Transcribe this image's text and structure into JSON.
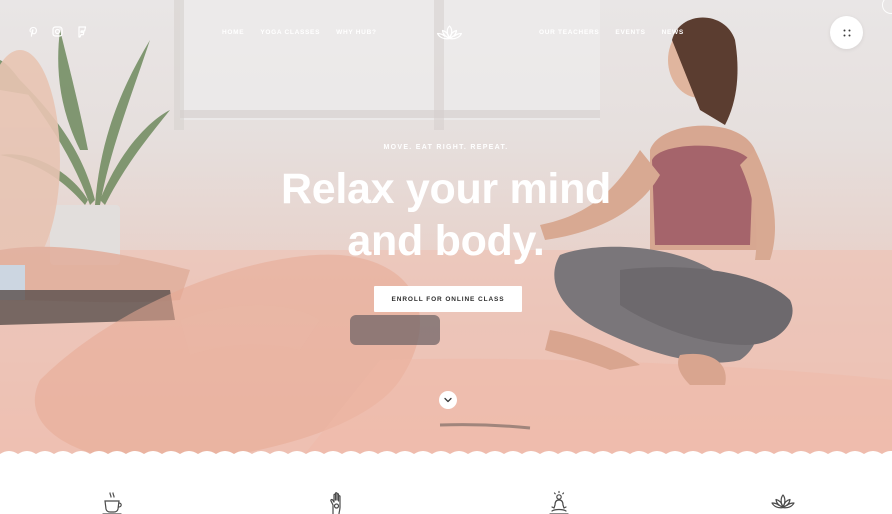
{
  "social": [
    {
      "icon": "pinterest-icon"
    },
    {
      "icon": "instagram-icon"
    },
    {
      "icon": "foursquare-icon"
    }
  ],
  "nav": {
    "left": [
      {
        "label": "HOME"
      },
      {
        "label": "YOGA CLASSES"
      },
      {
        "label": "WHY HUB?"
      }
    ],
    "right": [
      {
        "label": "OUR TEACHERS"
      },
      {
        "label": "EVENTS"
      },
      {
        "label": "NEWS"
      }
    ],
    "logo_icon": "lotus-logo-icon",
    "menu_icon": "menu-dots-icon"
  },
  "hero": {
    "tagline": "MOVE. EAT RIGHT. REPEAT.",
    "headline_line1": "Relax your mind",
    "headline_line2": "and body.",
    "cta_label": "ENROLL FOR ONLINE CLASS",
    "scroll_icon": "chevron-down-icon"
  },
  "features": [
    {
      "icon": "tea-cup-icon"
    },
    {
      "icon": "hand-icon"
    },
    {
      "icon": "meditation-icon"
    },
    {
      "icon": "lotus-icon"
    }
  ],
  "colors": {
    "accent": "#e8b4a3",
    "text_light": "#ffffff",
    "icon_dark": "#4a4a4a",
    "button_text": "#2d2d2d"
  }
}
